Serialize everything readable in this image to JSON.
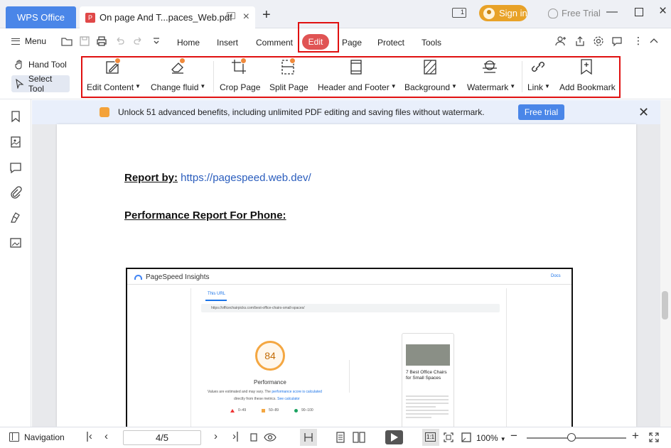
{
  "titlebar": {
    "app_tab": "WPS Office",
    "doc_tab": "On page And T...paces_Web.pdf",
    "new_tab": "+",
    "sign_in": "Sign in",
    "free_trial": "Free Trial"
  },
  "menubar": {
    "menu": "Menu",
    "tabs": [
      "Home",
      "Insert",
      "Comment",
      "Edit",
      "Page",
      "Protect",
      "Tools"
    ],
    "active_tab": "Edit"
  },
  "ribbon": {
    "hand_tool": "Hand Tool",
    "select_tool": "Select Tool",
    "buttons": [
      {
        "label": "Edit Content",
        "dropdown": true
      },
      {
        "label": "Change fluid",
        "dropdown": true
      },
      {
        "label": "Crop Page",
        "dropdown": false
      },
      {
        "label": "Split Page",
        "dropdown": false
      },
      {
        "label": "Header and Footer",
        "dropdown": true
      },
      {
        "label": "Background",
        "dropdown": true
      },
      {
        "label": "Watermark",
        "dropdown": true
      },
      {
        "label": "Link",
        "dropdown": true
      },
      {
        "label": "Add Bookmark",
        "dropdown": false
      }
    ]
  },
  "banner": {
    "text": "Unlock 51 advanced benefits, including unlimited PDF editing and saving files without watermark.",
    "button": "Free trial"
  },
  "document": {
    "report_by_label": "Report by:",
    "report_by_url": "https://pagespeed.web.dev/",
    "performance_heading": "Performance Report For Phone:",
    "pagespeed": {
      "logo_text": "PageSpeed Insights",
      "docs": "Docs",
      "this_url": "This URL",
      "url": "https://officechairpicks.com/best-office-chairs-small-spaces/",
      "score": "84",
      "score_label": "Performance",
      "desc_line1_a": "Values are estimated and may vary. The ",
      "desc_line1_link": "performance score is calculated",
      "desc_line2_a": "directly from these metrics. ",
      "desc_line2_link": "See calculator",
      "legend": [
        "0–49",
        "50–89",
        "90–100"
      ],
      "phone_title": "7 Best Office Chairs for Small Spaces"
    }
  },
  "statusbar": {
    "navigation": "Navigation",
    "page": "4/5",
    "zoom": "100%",
    "zoom_level_fraction": 0.45
  },
  "colors": {
    "accent": "#4a86e8",
    "edit_active": "#e05454",
    "highlight_box": "#e01010",
    "score_orange": "#f4a742"
  }
}
